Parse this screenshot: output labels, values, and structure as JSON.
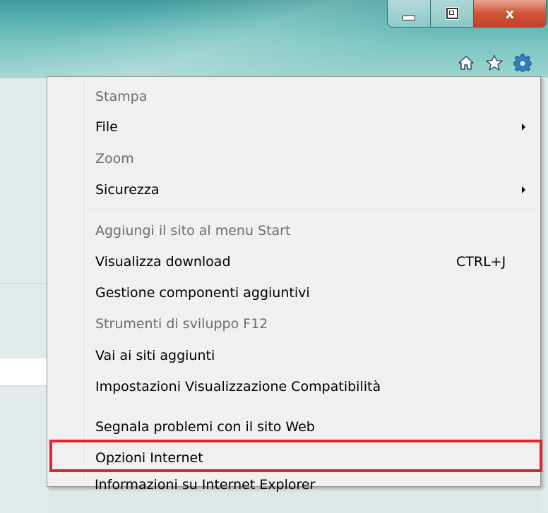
{
  "window": {
    "controls": {
      "minimize": "minimize",
      "maximize": "restore",
      "close": "x"
    },
    "toolbar": {
      "home_icon": "home-icon",
      "favorites_icon": "star-icon",
      "tools_icon": "gear-icon"
    },
    "colors": {
      "chrome": "#58b0b2",
      "close": "#cf5536",
      "highlight": "#e3242b"
    }
  },
  "menu": {
    "items": [
      {
        "label": "Stampa",
        "disabled": true
      },
      {
        "label": "File",
        "submenu": true
      },
      {
        "label": "Zoom",
        "disabled": true
      },
      {
        "label": "Sicurezza",
        "submenu": true
      },
      {
        "label": "Aggiungi il sito al menu Start",
        "disabled": true
      },
      {
        "label": "Visualizza download",
        "shortcut": "CTRL+J"
      },
      {
        "label": "Gestione componenti aggiuntivi"
      },
      {
        "label": "Strumenti di sviluppo F12",
        "disabled": true
      },
      {
        "label": "Vai ai siti aggiunti"
      },
      {
        "label": "Impostazioni Visualizzazione Compatibilità"
      },
      {
        "label": "Segnala problemi con il sito Web"
      },
      {
        "label": "Opzioni Internet",
        "highlighted": true
      },
      {
        "label": "Informazioni su Internet Explorer"
      }
    ]
  }
}
